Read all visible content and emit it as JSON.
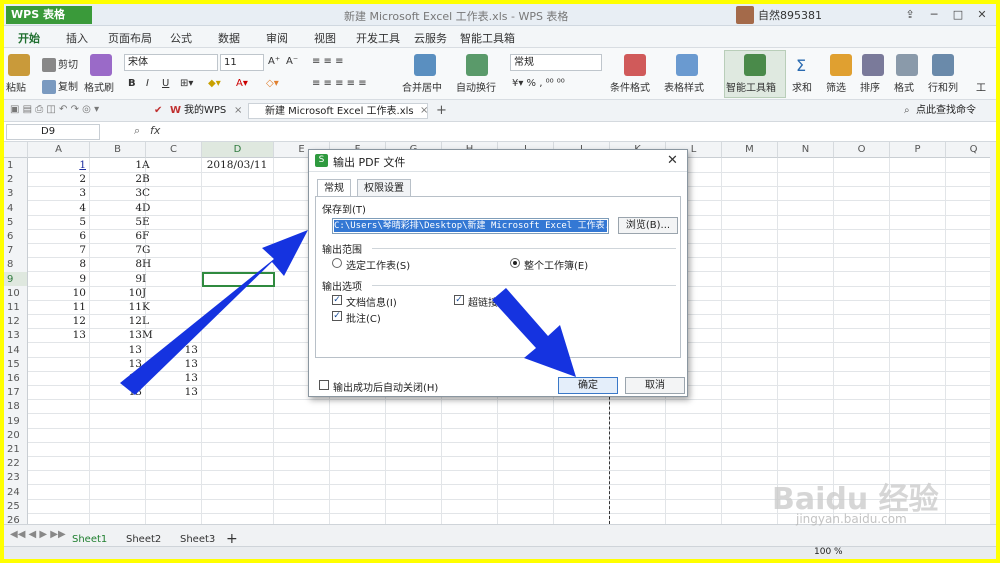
{
  "app": {
    "name": "WPS 表格",
    "doc_title": "新建 Microsoft Excel 工作表.xls - WPS 表格",
    "user": "自然895381"
  },
  "ribbon_tabs": [
    "开始",
    "插入",
    "页面布局",
    "公式",
    "数据",
    "审阅",
    "视图",
    "开发工具",
    "云服务",
    "智能工具箱"
  ],
  "ribbon": {
    "paste": "粘贴",
    "cut": "剪切",
    "copy": "复制",
    "format_painter": "格式刷",
    "font_name": "宋体",
    "font_size": "11",
    "bold": "B",
    "italic": "I",
    "underline": "U",
    "merge": "合并居中",
    "wrap": "自动换行",
    "number_format": "常规",
    "cond_format": "条件格式",
    "table_style": "表格样式",
    "smart_toolbox": "智能工具箱",
    "sum": "求和",
    "filter": "筛选",
    "sort": "排序",
    "format": "格式",
    "rowcol": "行和列",
    "sheet": "工"
  },
  "quick": {
    "my_wps": "我的WPS",
    "doc_tab": "新建 Microsoft Excel 工作表.xls",
    "search_hint": "点此查找命令"
  },
  "formula": {
    "name_box": "D9",
    "fx": "fx"
  },
  "columns": [
    "A",
    "B",
    "C",
    "D",
    "E",
    "F",
    "G",
    "H",
    "I",
    "J",
    "K",
    "L",
    "M",
    "N",
    "O",
    "P",
    "Q"
  ],
  "rows": [
    "1",
    "2",
    "3",
    "4",
    "5",
    "6",
    "7",
    "8",
    "9",
    "10",
    "11",
    "12",
    "13",
    "14",
    "15",
    "16",
    "17",
    "18",
    "19",
    "20",
    "21",
    "22",
    "23",
    "24",
    "25",
    "26"
  ],
  "cells": {
    "colA": [
      "1",
      "2",
      "3",
      "4",
      "5",
      "6",
      "7",
      "8",
      "9",
      "10",
      "11",
      "12",
      "13"
    ],
    "colB": [
      "1",
      "2",
      "3",
      "4",
      "5",
      "6",
      "7",
      "8",
      "9",
      "10",
      "11",
      "12",
      "13",
      "13",
      "13",
      "13",
      "13"
    ],
    "colC_letters": [
      "A",
      "B",
      "C",
      "D",
      "E",
      "F",
      "G",
      "H",
      "I",
      "J",
      "K",
      "L",
      "M"
    ],
    "colC_nums": [
      "13",
      "13",
      "13",
      "13"
    ],
    "d1": "2018/03/11"
  },
  "sheets": [
    "Sheet1",
    "Sheet2",
    "Sheet3"
  ],
  "status": {
    "zoom": "100 %"
  },
  "dialog": {
    "title": "输出 PDF 文件",
    "tabs": [
      "常规",
      "权限设置"
    ],
    "save_to_label": "保存到(T)",
    "path": "C:\\Users\\琴晴彩排\\Desktop\\新建 Microsoft Excel 工作表.pdf",
    "browse": "浏览(B)...",
    "range_label": "输出范围",
    "range_selected": "选定工作表(S)",
    "range_all": "整个工作簿(E)",
    "options_label": "输出选项",
    "opt_docinfo": "文档信息(I)",
    "opt_hyperlink": "超链接(L)",
    "opt_comment": "批注(C)",
    "close_after": "输出成功后自动关闭(H)",
    "ok": "确定",
    "cancel": "取消"
  },
  "watermark": {
    "brand": "Baidu 经验",
    "url": "jingyan.baidu.com"
  }
}
